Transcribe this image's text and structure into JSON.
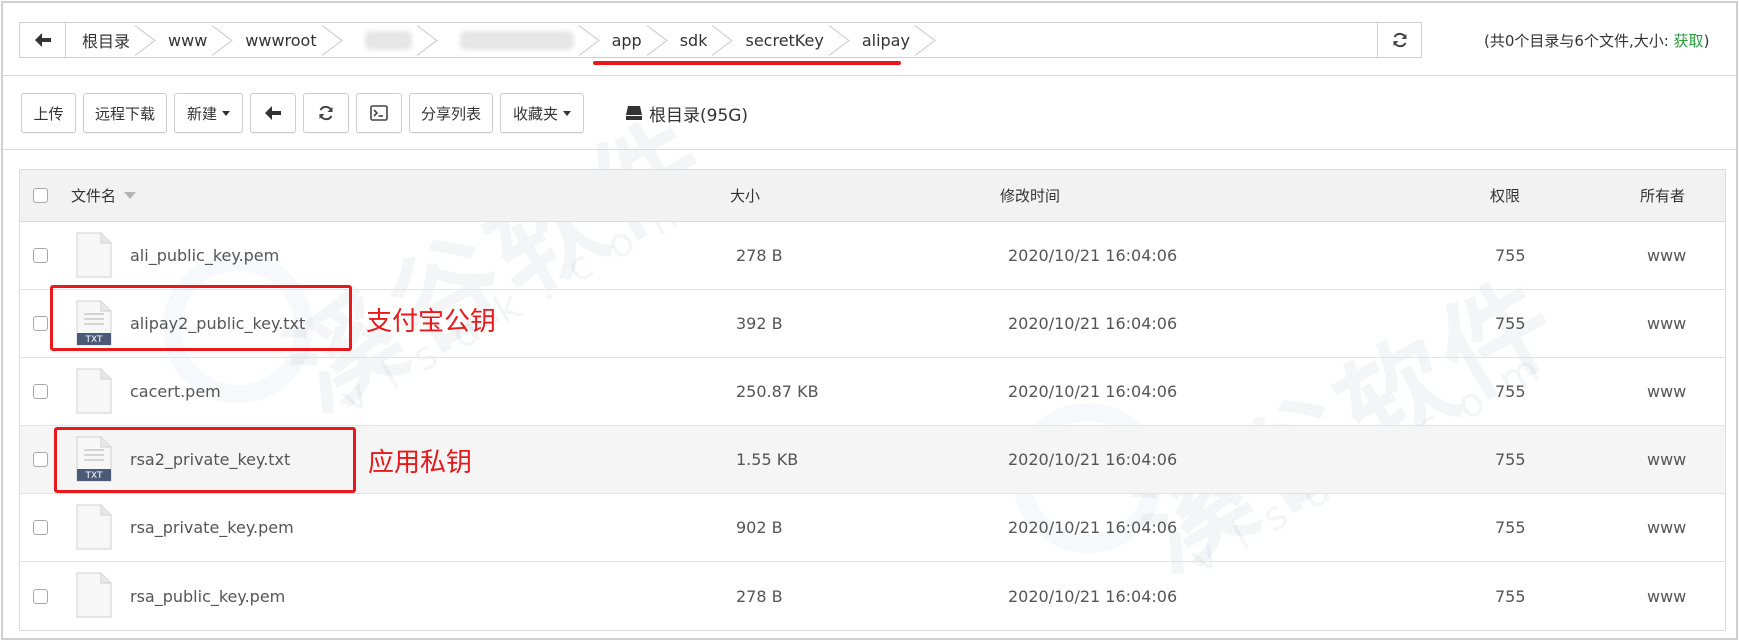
{
  "breadcrumb": {
    "items": [
      {
        "label": "根目录",
        "blurred": false
      },
      {
        "label": "www",
        "blurred": false
      },
      {
        "label": "wwwroot",
        "blurred": false
      },
      {
        "label": "xxxxx",
        "blurred": true
      },
      {
        "label": "xxxxxxxxxxxx",
        "blurred": true
      },
      {
        "label": "app",
        "blurred": false
      },
      {
        "label": "sdk",
        "blurred": false
      },
      {
        "label": "secretKey",
        "blurred": false
      },
      {
        "label": "alipay",
        "blurred": false
      }
    ],
    "summary_prefix": "(共0个目录与6个文件,大小:",
    "summary_link": "获取",
    "summary_suffix": ")"
  },
  "toolbar": {
    "upload": "上传",
    "remote_download": "远程下载",
    "new": "新建",
    "share_list": "分享列表",
    "favorites": "收藏夹",
    "disk_label": "根目录(95G)"
  },
  "table": {
    "headers": {
      "name": "文件名",
      "size": "大小",
      "modified": "修改时间",
      "permission": "权限",
      "owner": "所有者"
    },
    "rows": [
      {
        "name": "ali_public_key.pem",
        "icon": "blank-file-icon",
        "size": "278 B",
        "modified": "2020/10/21 16:04:06",
        "permission": "755",
        "owner": "www"
      },
      {
        "name": "alipay2_public_key.txt",
        "icon": "txt-file-icon",
        "size": "392 B",
        "modified": "2020/10/21 16:04:06",
        "permission": "755",
        "owner": "www"
      },
      {
        "name": "cacert.pem",
        "icon": "blank-file-icon",
        "size": "250.87 KB",
        "modified": "2020/10/21 16:04:06",
        "permission": "755",
        "owner": "www"
      },
      {
        "name": "rsa2_private_key.txt",
        "icon": "txt-file-icon",
        "size": "1.55 KB",
        "modified": "2020/10/21 16:04:06",
        "permission": "755",
        "owner": "www"
      },
      {
        "name": "rsa_private_key.pem",
        "icon": "blank-file-icon",
        "size": "902 B",
        "modified": "2020/10/21 16:04:06",
        "permission": "755",
        "owner": "www"
      },
      {
        "name": "rsa_public_key.pem",
        "icon": "blank-file-icon",
        "size": "278 B",
        "modified": "2020/10/21 16:04:06",
        "permission": "755",
        "owner": "www"
      }
    ]
  },
  "annotations": {
    "alipay_public_key": "支付宝公钥",
    "app_private_key": "应用私钥"
  },
  "txt_badge": "TXT",
  "watermark": {
    "text": "溪谷软件",
    "sub": "vlsdk.com"
  },
  "colors": {
    "annotation_red": "#e8191b",
    "fetch_link_green": "#2a9d3c",
    "header_bg": "#f2f2f2",
    "row_shade": "#f5f5f5"
  }
}
